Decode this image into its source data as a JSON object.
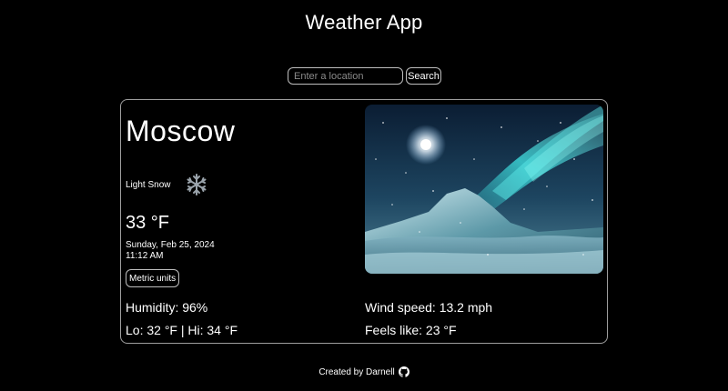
{
  "header": {
    "title": "Weather App"
  },
  "search": {
    "placeholder": "Enter a location",
    "value": "",
    "button_label": "Search"
  },
  "weather": {
    "city": "Moscow",
    "condition": "Light Snow",
    "condition_icon": "snowflake-icon",
    "temperature": "33 °F",
    "date": "Sunday, Feb 25, 2024",
    "time": "11:12 AM",
    "units_button_label": "Metric units",
    "humidity": "Humidity: 96%",
    "lo_hi": "Lo: 32 °F | Hi: 34 °F",
    "wind_speed": "Wind speed: 13.2 mph",
    "feels_like": "Feels like: 23 °F",
    "image": "snowy-aurora-mountain-image"
  },
  "footer": {
    "credit": "Created by Darnell",
    "link_icon": "github-icon"
  },
  "colors": {
    "background": "#000000",
    "text": "#ffffff",
    "border": "#9e9e9e",
    "placeholder": "#8a8a8a",
    "aurora": "#3fe6e6",
    "snow_icon": "#9aa3ab"
  }
}
